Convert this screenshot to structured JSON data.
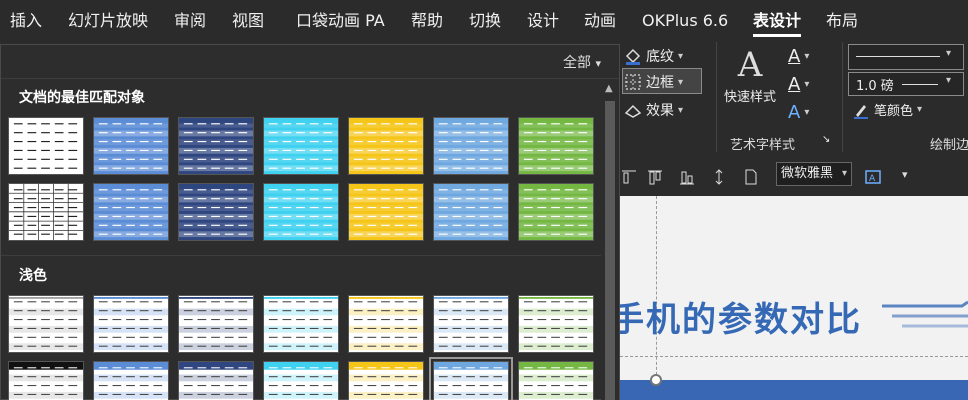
{
  "tabs": [
    "插入",
    "幻灯片放映",
    "审阅",
    "视图",
    "口袋动画 PA",
    "帮助",
    "切换",
    "设计",
    "动画",
    "OKPlus 6.6",
    "表设计",
    "布局"
  ],
  "active_tab": "表设计",
  "ribbon": {
    "shading": "底纹",
    "border": "边框",
    "effects": "效果",
    "quick_styles": "快速样式",
    "wordart_group": "艺术字样式",
    "pen_weight": "1.0 磅",
    "pen_color": "笔颜色",
    "draw_group": "绘制边"
  },
  "font_name": "微软雅黑",
  "gallery": {
    "all_label": "全部",
    "best_match_label": "文档的最佳匹配对象",
    "light_label": "浅色"
  },
  "slide": {
    "title_fragment": "手机的参数对比"
  },
  "colors": {
    "plain": "#ffffff",
    "blue": "#5b8dd6",
    "navy": "#2f4680",
    "cyan": "#3fd1f0",
    "gold": "#f5c518",
    "sky": "#6fa8e0",
    "green": "#74b843",
    "black": "#111111",
    "gray": "#a0a0a0"
  }
}
